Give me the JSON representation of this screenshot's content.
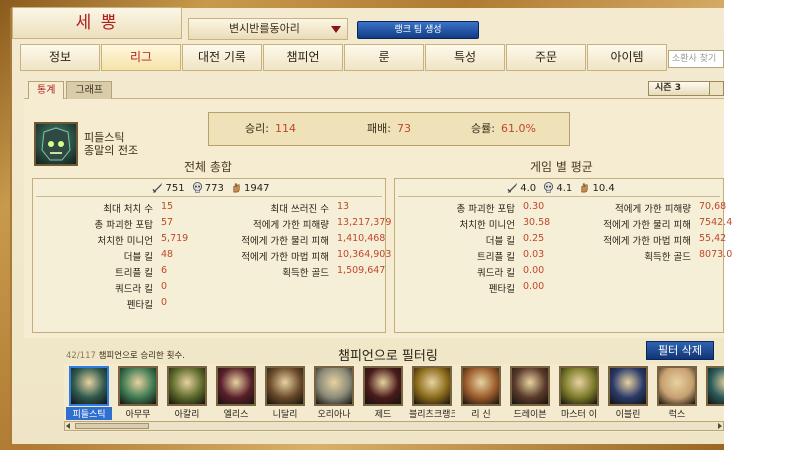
{
  "header": {
    "summoner_name": "세 뽕",
    "summoner_select": "변시반를동아리",
    "rank_team_button": "랭크 팀 생성"
  },
  "main_tabs": [
    {
      "label": "정보",
      "active": false
    },
    {
      "label": "리그",
      "active": true
    },
    {
      "label": "대전 기록",
      "active": false
    },
    {
      "label": "챔피언",
      "active": false
    },
    {
      "label": "룬",
      "active": false
    },
    {
      "label": "특성",
      "active": false
    },
    {
      "label": "주문",
      "active": false
    },
    {
      "label": "아이템",
      "active": false
    }
  ],
  "search": {
    "placeholder": "소환사 찾기"
  },
  "sub_tabs": [
    {
      "label": "통계",
      "active": true
    },
    {
      "label": "그래프",
      "active": false
    }
  ],
  "season": "시즌 3",
  "champion": {
    "name_line1": "피들스틱",
    "name_line2": "종말의 전조"
  },
  "record": {
    "wins_label": "승리:",
    "wins": "114",
    "losses_label": "패배:",
    "losses": "73",
    "winrate_label": "승률:",
    "winrate": "61.0%"
  },
  "overall": {
    "title": "전체 총합",
    "kills": "751",
    "deaths": "773",
    "assists": "1947",
    "left": [
      {
        "label": "최대 처치 수",
        "value": "15"
      },
      {
        "label": "총 파괴한 포탑",
        "value": "57"
      },
      {
        "label": "처치한 미니언",
        "value": "5,719"
      },
      {
        "label": "더블 킬",
        "value": "48"
      },
      {
        "label": "트리플 킬",
        "value": "6"
      },
      {
        "label": "쿼드라 킬",
        "value": "0"
      },
      {
        "label": "펜타킬",
        "value": "0"
      }
    ],
    "right": [
      {
        "label": "최대 쓰러진 수",
        "value": "13"
      },
      {
        "label": "적에게 가한 피해량",
        "value": "13,217,379"
      },
      {
        "label": "적에게 가한 물리 피해",
        "value": "1,410,468"
      },
      {
        "label": "적에게 가한 마법 피해",
        "value": "10,364,903"
      },
      {
        "label": "획득한 골드",
        "value": "1,509,647"
      }
    ]
  },
  "average": {
    "title": "게임 별 평균",
    "kills": "4.0",
    "deaths": "4.1",
    "assists": "10.4",
    "left": [
      {
        "label": "총 파괴한 포탑",
        "value": "0.30"
      },
      {
        "label": "처치한 미니언",
        "value": "30.58"
      },
      {
        "label": "더블 킬",
        "value": "0.25"
      },
      {
        "label": "트리플 킬",
        "value": "0.03"
      },
      {
        "label": "쿼드라 킬",
        "value": "0.00"
      },
      {
        "label": "펜타킬",
        "value": "0.00"
      }
    ],
    "right": [
      {
        "label": "적에게 가한 피해량",
        "value": "70,68"
      },
      {
        "label": "적에게 가한 물리 피해",
        "value": "7542.4"
      },
      {
        "label": "적에게 가한 마법 피해",
        "value": "55,42"
      },
      {
        "label": "획득한 골드",
        "value": "8073.0"
      }
    ]
  },
  "filter": {
    "count": "42/117",
    "hint": "챔피언으로 승리한 횟수.",
    "title": "챔피언으로 필터링",
    "clear_button": "필터 삭제"
  },
  "champions": [
    {
      "name": "피들스틱",
      "color": "#2f5a4e",
      "selected": true
    },
    {
      "name": "아무무",
      "color": "#3f7a52",
      "selected": false
    },
    {
      "name": "아칼리",
      "color": "#5c6a2a",
      "selected": false
    },
    {
      "name": "엘리스",
      "color": "#5a1f2a",
      "selected": false
    },
    {
      "name": "니달리",
      "color": "#6a4a2a",
      "selected": false
    },
    {
      "name": "오리아나",
      "color": "#8a8a78",
      "selected": false
    },
    {
      "name": "제드",
      "color": "#4a1a1a",
      "selected": false
    },
    {
      "name": "블리츠크랭크",
      "color": "#8a6a1a",
      "selected": false
    },
    {
      "name": "리 신",
      "color": "#9a5a2a",
      "selected": false
    },
    {
      "name": "드레이븐",
      "color": "#5a3a2a",
      "selected": false
    },
    {
      "name": "마스터 이",
      "color": "#7a7a2a",
      "selected": false
    },
    {
      "name": "이블린",
      "color": "#2a3a6a",
      "selected": false
    },
    {
      "name": "럭스",
      "color": "#c8a070",
      "selected": false
    },
    {
      "name": "",
      "color": "#2a5a5a",
      "selected": false
    }
  ]
}
